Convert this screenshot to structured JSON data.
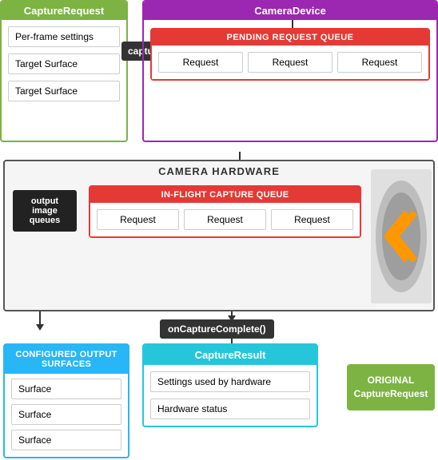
{
  "captureRequest": {
    "title": "CaptureRequest",
    "items": [
      "Per-frame settings",
      "Target Surface",
      "Target Surface"
    ]
  },
  "captureBtn": "capture()",
  "cameraDevice": {
    "title": "CameraDevice"
  },
  "pendingQueue": {
    "title": "PENDING REQUEST QUEUE",
    "items": [
      "Request",
      "Request",
      "Request"
    ]
  },
  "cameraHardware": {
    "title": "CAMERA HARDWARE"
  },
  "outputImageQueues": "output image queues",
  "inflightQueue": {
    "title": "IN-FLIGHT CAPTURE QUEUE",
    "items": [
      "Request",
      "Request",
      "Request"
    ]
  },
  "onCaptureComplete": "onCaptureComplete()",
  "configuredSurfaces": {
    "title": "CONFIGURED OUTPUT SURFACES",
    "items": [
      "Surface",
      "Surface",
      "Surface"
    ]
  },
  "captureResult": {
    "title": "CaptureResult",
    "items": [
      "Settings used by hardware",
      "Hardware status"
    ]
  },
  "originalCapture": {
    "line1": "ORIGINAL",
    "line2": "CaptureRequest"
  }
}
